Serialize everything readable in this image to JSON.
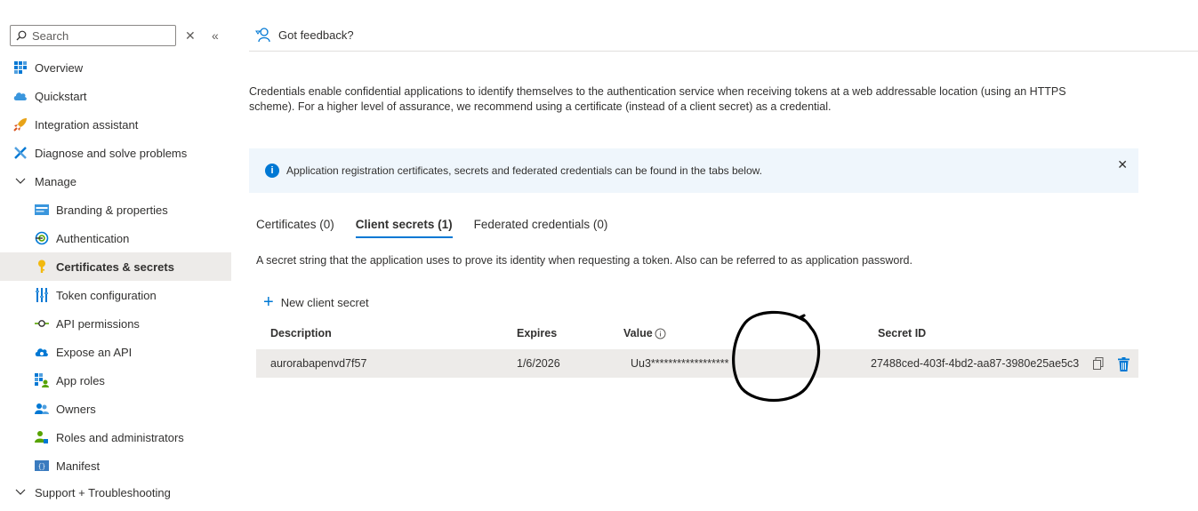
{
  "sidebar": {
    "search": {
      "placeholder": "Search"
    },
    "clear_icon": "close-icon",
    "collapse_icon": "double-chevron-left-icon",
    "items": [
      {
        "label": "Overview",
        "icon": "overview-icon"
      },
      {
        "label": "Quickstart",
        "icon": "quickstart-icon"
      },
      {
        "label": "Integration assistant",
        "icon": "rocket-icon"
      },
      {
        "label": "Diagnose and solve problems",
        "icon": "wrench-icon"
      },
      {
        "label": "Manage",
        "icon": "chevron-down-icon"
      },
      {
        "label": "Branding & properties",
        "icon": "branding-icon"
      },
      {
        "label": "Authentication",
        "icon": "authentication-icon"
      },
      {
        "label": "Certificates & secrets",
        "icon": "key-icon"
      },
      {
        "label": "Token configuration",
        "icon": "token-icon"
      },
      {
        "label": "API permissions",
        "icon": "api-permissions-icon"
      },
      {
        "label": "Expose an API",
        "icon": "cloud-icon"
      },
      {
        "label": "App roles",
        "icon": "app-roles-icon"
      },
      {
        "label": "Owners",
        "icon": "owners-icon"
      },
      {
        "label": "Roles and administrators",
        "icon": "roles-icon"
      },
      {
        "label": "Manifest",
        "icon": "manifest-icon"
      },
      {
        "label": "Support + Troubleshooting",
        "icon": "chevron-down-icon"
      }
    ]
  },
  "header": {
    "feedback_label": "Got feedback?"
  },
  "main": {
    "description": "Credentials enable confidential applications to identify themselves to the authentication service when receiving tokens at a web addressable location (using an HTTPS scheme). For a higher level of assurance, we recommend using a certificate (instead of a client secret) as a credential.",
    "info_banner": "Application registration certificates, secrets and federated credentials can be found in the tabs below.",
    "tabs": [
      {
        "label": "Certificates (0)"
      },
      {
        "label": "Client secrets (1)"
      },
      {
        "label": "Federated credentials (0)"
      }
    ],
    "tab_description": "A secret string that the application uses to prove its identity when requesting a token. Also can be referred to as application password.",
    "new_secret_label": "New client secret",
    "table": {
      "columns": {
        "description": "Description",
        "expires": "Expires",
        "value": "Value",
        "secret_id": "Secret ID"
      },
      "rows": [
        {
          "description": "aurorabapenvd7f57",
          "expires": "1/6/2026",
          "value": "Uu3******************",
          "secret_id": "27488ced-403f-4bd2-aa87-3980e25ae5c3"
        }
      ]
    }
  },
  "colors": {
    "accent": "#0078d4",
    "active_bg": "#edebe9",
    "info_bg": "#eff6fc"
  }
}
